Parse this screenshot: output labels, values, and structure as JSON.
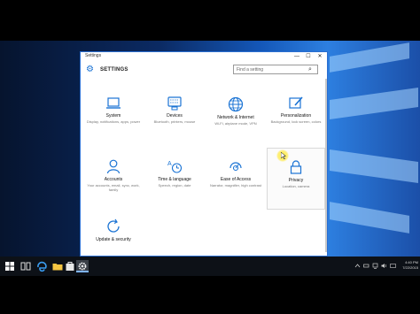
{
  "window": {
    "title": "Settings",
    "header_label": "SETTINGS",
    "search_placeholder": "Find a setting",
    "controls": {
      "minimize": "—",
      "maximize": "☐",
      "close": "✕"
    }
  },
  "tiles": [
    {
      "id": "system",
      "label": "System",
      "desc": "Display, notifications, apps, power",
      "icon": "laptop-icon"
    },
    {
      "id": "devices",
      "label": "Devices",
      "desc": "Bluetooth, printers, mouse",
      "icon": "keyboard-icon"
    },
    {
      "id": "network",
      "label": "Network & Internet",
      "desc": "Wi-Fi, airplane mode, VPN",
      "icon": "globe-icon"
    },
    {
      "id": "personalization",
      "label": "Personalization",
      "desc": "Background, lock screen, colors",
      "icon": "pen-icon"
    },
    {
      "id": "accounts",
      "label": "Accounts",
      "desc": "Your accounts, email, sync, work, family",
      "icon": "person-icon"
    },
    {
      "id": "time",
      "label": "Time & language",
      "desc": "Speech, region, date",
      "icon": "clock-language-icon"
    },
    {
      "id": "ease",
      "label": "Ease of Access",
      "desc": "Narrator, magnifier, high contrast",
      "icon": "accessibility-icon"
    },
    {
      "id": "privacy",
      "label": "Privacy",
      "desc": "Location, camera",
      "icon": "lock-icon"
    },
    {
      "id": "update",
      "label": "Update & security",
      "desc": "",
      "icon": "refresh-icon"
    }
  ],
  "accent_color": "#1a73d4",
  "taskbar": {
    "time": "4:40 PM",
    "date": "7/22/2015"
  }
}
